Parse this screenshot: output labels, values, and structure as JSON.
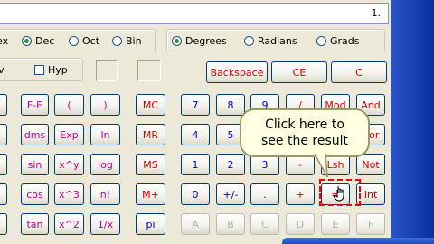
{
  "display": {
    "value": "1."
  },
  "base_radios": [
    {
      "label": "ex",
      "selected": false
    },
    {
      "label": "Dec",
      "selected": true
    },
    {
      "label": "Oct",
      "selected": false
    },
    {
      "label": "Bin",
      "selected": false
    }
  ],
  "angle_radios": [
    {
      "label": "Degrees",
      "selected": true
    },
    {
      "label": "Radians",
      "selected": false
    },
    {
      "label": "Grads",
      "selected": false
    }
  ],
  "checkboxes": {
    "inv": "v",
    "hyp": "Hyp"
  },
  "edit_buttons": {
    "backspace": "Backspace",
    "ce": "CE",
    "c": "C"
  },
  "sci_col1": [
    "F-E",
    "dms",
    "sin",
    "cos",
    "tan"
  ],
  "sci_col2": [
    "(",
    "Exp",
    "x^y",
    "x^3",
    "x^2"
  ],
  "sci_col3": [
    ")",
    "ln",
    "log",
    "n!",
    "1/x"
  ],
  "memory": [
    "MC",
    "MR",
    "MS",
    "M+",
    "pi"
  ],
  "digits_col1": [
    "7",
    "4",
    "1",
    "0",
    "A"
  ],
  "digits_col2": [
    "8",
    "5",
    "2",
    "+/-",
    "B"
  ],
  "digits_col3": [
    "9",
    "6",
    "3",
    ".",
    "C"
  ],
  "ops_col1": [
    "/",
    "*",
    "-",
    "+",
    "D"
  ],
  "ops_col2": [
    "Mod",
    "Or",
    "Lsh",
    "=",
    "E"
  ],
  "ops_col3": [
    "And",
    "Xor",
    "Not",
    "Int",
    "F"
  ],
  "callout": {
    "line1": "Click here to",
    "line2": "see the result"
  },
  "colors": {
    "blue": "#0000c8",
    "red": "#d00000",
    "magenta": "#c00090",
    "window": "#ece9d8"
  }
}
